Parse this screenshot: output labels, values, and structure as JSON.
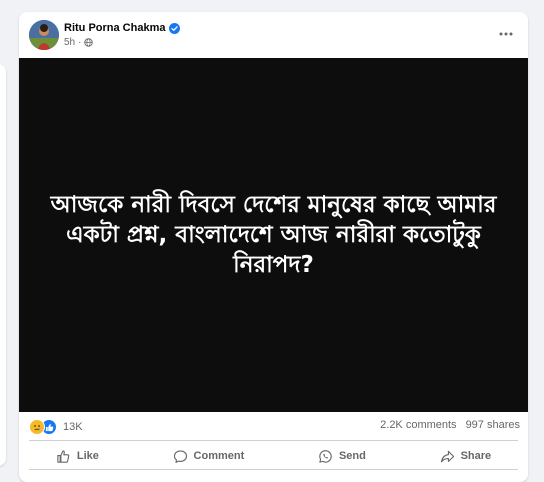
{
  "post": {
    "author": "Ritu Porna Chakma",
    "time": "5h",
    "image_text": "আজকে নারী দিবসে দেশের মানুষের কাছে আমার একটা প্রশ্ন, বাংলাদেশে আজ নারীরা কতোটুকু নিরাপদ?",
    "reaction_count": "13K",
    "comments": "2.2K comments",
    "shares": "997 shares"
  },
  "actions": {
    "like": "Like",
    "comment": "Comment",
    "send": "Send",
    "share": "Share"
  },
  "colors": {
    "brand": "#1877f2",
    "media_bg": "#0d0d0d",
    "secondary_text": "#65676b"
  },
  "icons": [
    "verified-badge-icon",
    "globe-icon",
    "more-options-icon",
    "sad-reaction-icon",
    "like-reaction-icon",
    "thumbs-up-icon",
    "comment-bubble-icon",
    "whatsapp-send-icon",
    "share-arrow-icon"
  ]
}
